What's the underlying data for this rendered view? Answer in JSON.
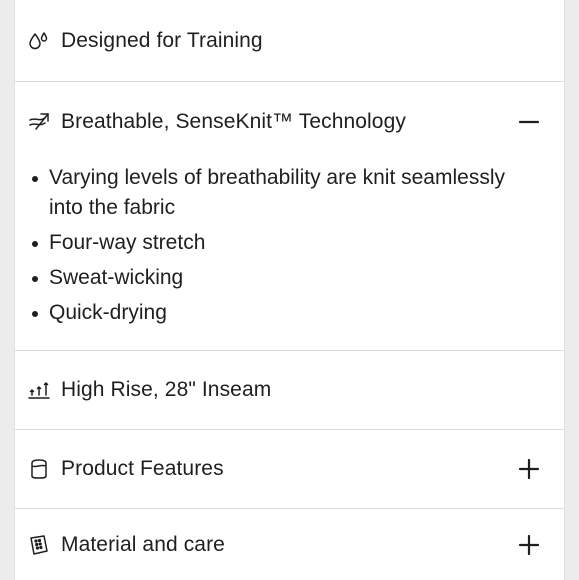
{
  "accordion": {
    "items": [
      {
        "label": "Designed for Training",
        "icon": "droplets-icon"
      },
      {
        "label": "Breathable, SenseKnit™ Technology",
        "icon": "airflow-icon",
        "expanded": true,
        "toggle": "minus-icon",
        "bullets": [
          "Varying levels of breathability are knit seamlessly into the fabric",
          "Four-way stretch",
          "Sweat-wicking",
          "Quick-drying"
        ]
      },
      {
        "label": "High Rise, 28\" Inseam",
        "icon": "rise-arrows-icon"
      },
      {
        "label": "Product Features",
        "icon": "fabric-icon",
        "toggle": "plus-icon"
      },
      {
        "label": "Material and care",
        "icon": "care-tag-icon",
        "toggle": "plus-icon"
      }
    ]
  }
}
